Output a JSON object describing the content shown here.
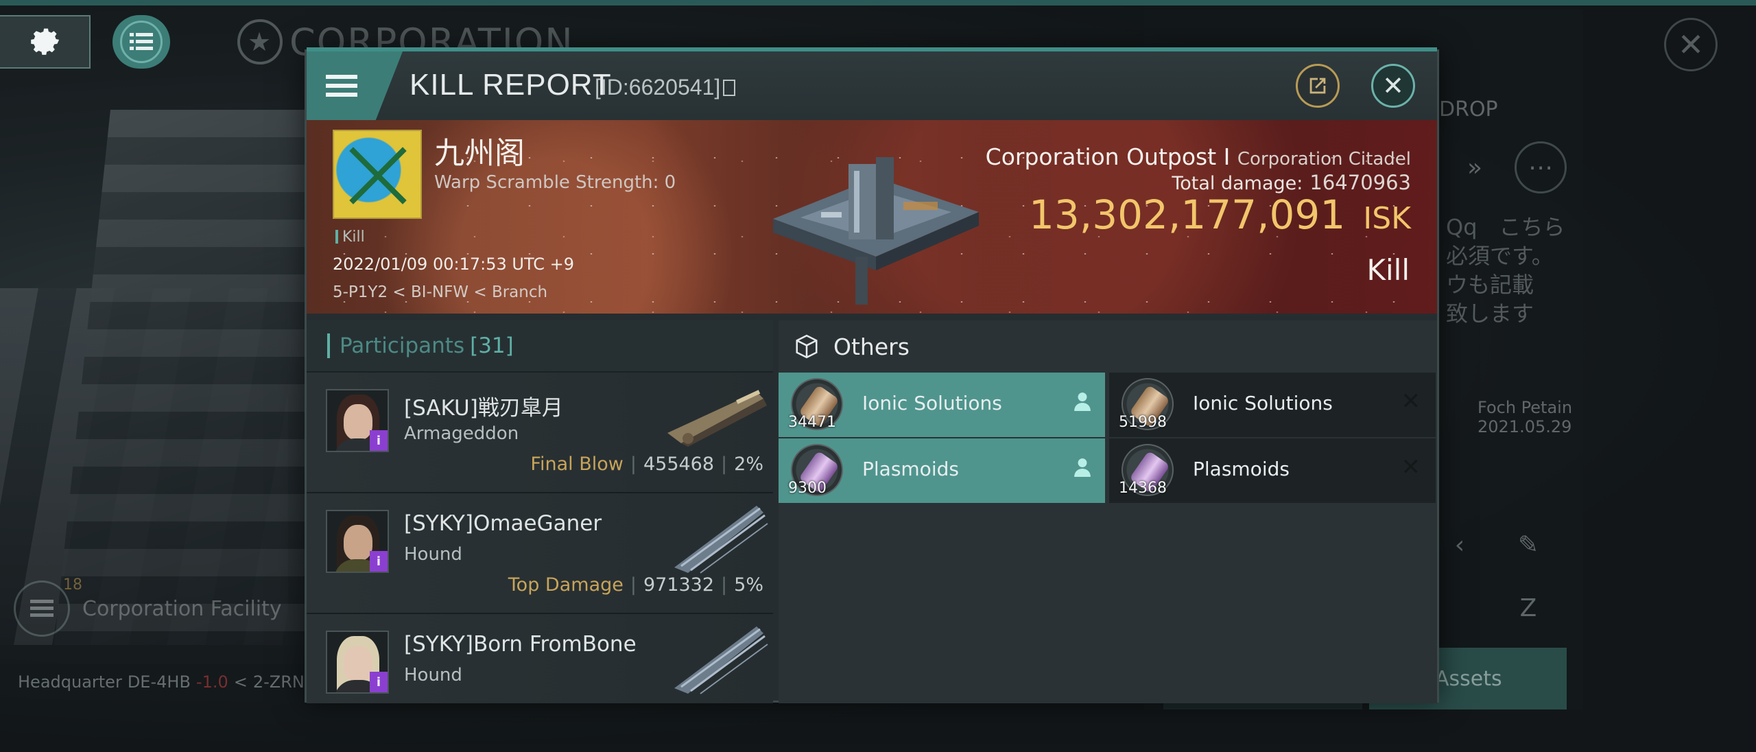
{
  "background": {
    "corp_title": "CORPORATION",
    "right_text_drop": "DROP",
    "right_jp_lines": [
      "Qq　こちら",
      "必須です。",
      "ウも記載",
      "致します"
    ],
    "right_name": "Foch Petain",
    "right_date": "2021.05.29",
    "assets_label": "Assets",
    "facility_label": "Corporation Facility",
    "facility_count": "18",
    "hq_label": "Headquarter",
    "hq_system": "DE-4HB",
    "hq_sec": "-1.0",
    "hq_next": "2-ZRN"
  },
  "header": {
    "title": "KILL REPORT",
    "id_text": "[ID:6620541]",
    "menu_icon": "menu-icon",
    "share_icon": "share-icon",
    "close_icon": "close-icon"
  },
  "victim": {
    "corp_name": "九州阁",
    "warp_scramble": "Warp Scramble Strength: 0",
    "tag": "Kill",
    "time": "2022/01/09 00:17:53 UTC +9",
    "location": "5-P1Y2 < BI-NFW < Branch",
    "structure": "Corporation Outpost Ⅰ",
    "structure_type": "Corporation Citadel",
    "total_damage_label": "Total damage:",
    "total_damage": "16470963",
    "isk_value": "13,302,177,091",
    "isk_unit": "ISK",
    "result": "Kill"
  },
  "participants": {
    "label": "Participants",
    "count": "[31]",
    "rows": [
      {
        "name": "[SAKU]戦刃皐月",
        "ship": "Armageddon",
        "role": "Final Blow",
        "damage": "455468",
        "percent": "2%"
      },
      {
        "name": "[SYKY]OmaeGaner",
        "ship": "Hound",
        "role": "Top Damage",
        "damage": "971332",
        "percent": "5%"
      },
      {
        "name": "[SYKY]Born FromBone",
        "ship": "Hound",
        "role": "",
        "damage": "",
        "percent": ""
      }
    ]
  },
  "others": {
    "label": "Others",
    "items": [
      {
        "name": "Ionic Solutions",
        "qty": "34471",
        "status": "dropped"
      },
      {
        "name": "Ionic Solutions",
        "qty": "51998",
        "status": "destroyed"
      },
      {
        "name": "Plasmoids",
        "qty": "9300",
        "status": "dropped"
      },
      {
        "name": "Plasmoids",
        "qty": "14368",
        "status": "destroyed"
      }
    ]
  },
  "colors": {
    "accent": "#3c7d77",
    "dropped": "#4f958e",
    "isk": "#f2c66b",
    "role": "#c8a45a"
  }
}
